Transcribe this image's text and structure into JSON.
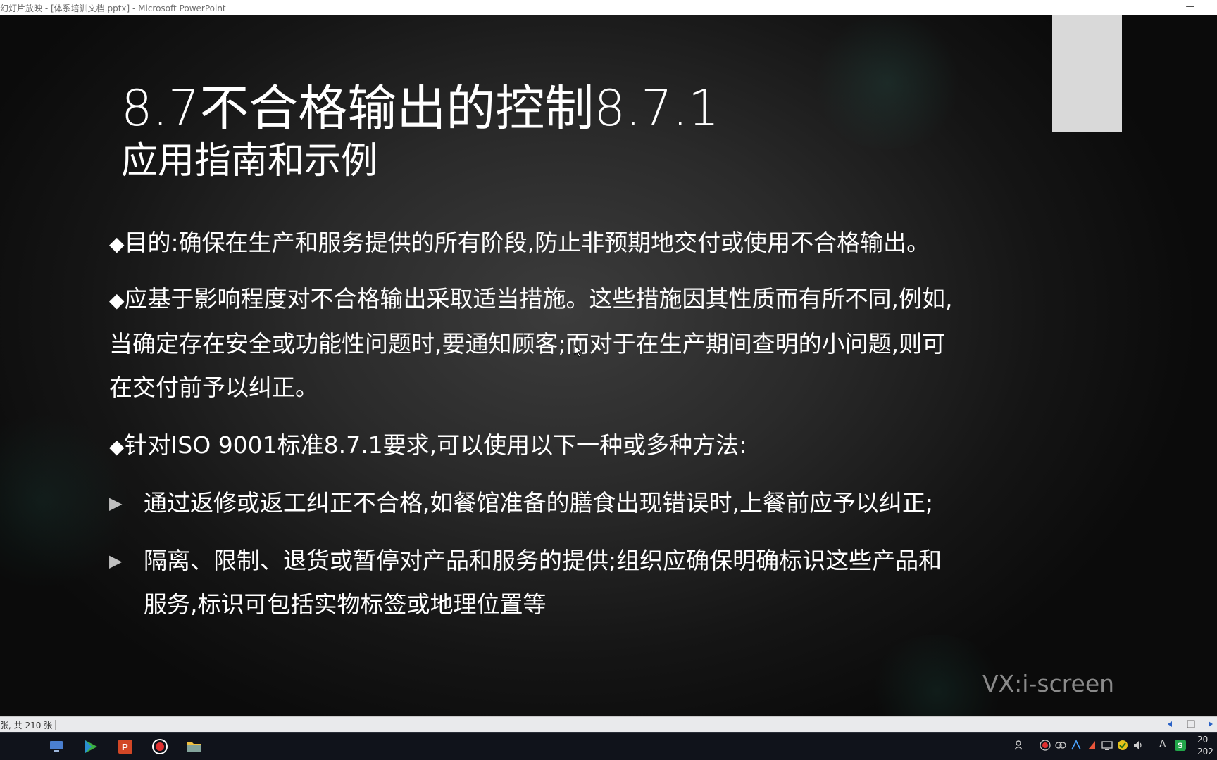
{
  "window": {
    "title": "幻灯片放映 - [体系培训文档.pptx] - Microsoft PowerPoint",
    "minimize_glyph": "—"
  },
  "slide": {
    "title_line1": "8.7不合格输出的控制8.7.1",
    "title_line2": "应用指南和示例",
    "bullets": [
      {
        "marker": "◆",
        "lines": [
          "目的:确保在生产和服务提供的所有阶段,防止非预期地交付或使用不合格输出。"
        ]
      },
      {
        "marker": "◆",
        "lines": [
          "应基于影响程度对不合格输出采取适当措施。这些措施因其性质而有所不同,例如,",
          "当确定存在安全或功能性问题时,要通知顾客;而对于在生产期间查明的小问题,则可",
          "在交付前予以纠正。"
        ]
      },
      {
        "marker": "◆",
        "lines": [
          "针对ISO 9001标准8.7.1要求,可以使用以下一种或多种方法:"
        ]
      }
    ],
    "sub_bullets": [
      {
        "marker": "▶",
        "lines": [
          "通过返修或返工纠正不合格,如餐馆准备的膳食出现错误时,上餐前应予以纠正;"
        ]
      },
      {
        "marker": "▶",
        "lines": [
          "隔离、限制、退货或暂停对产品和服务的提供;组织应确保明确标识这些产品和",
          "服务,标识可包括实物标签或地理位置等"
        ]
      }
    ],
    "watermark": "VX:i-screen",
    "colors": {
      "background": "#2a2a2a",
      "text": "#ffffff",
      "accent_block": "#d9d9d9",
      "watermark": "#8a8a8a"
    }
  },
  "statusbar": {
    "slide_info": "张, 共 210 张"
  },
  "taskbar": {
    "apps": [
      {
        "name": "computer-icon",
        "color": "#4a7fd0"
      },
      {
        "name": "media-player-icon",
        "color": "#3cb043"
      },
      {
        "name": "powerpoint-icon",
        "color": "#d24726"
      },
      {
        "name": "record-icon",
        "color": "#e03030"
      },
      {
        "name": "folder-icon",
        "color": "#f0c040"
      }
    ],
    "clock_line1": "20",
    "clock_line2": "202",
    "ime_label": "A"
  }
}
